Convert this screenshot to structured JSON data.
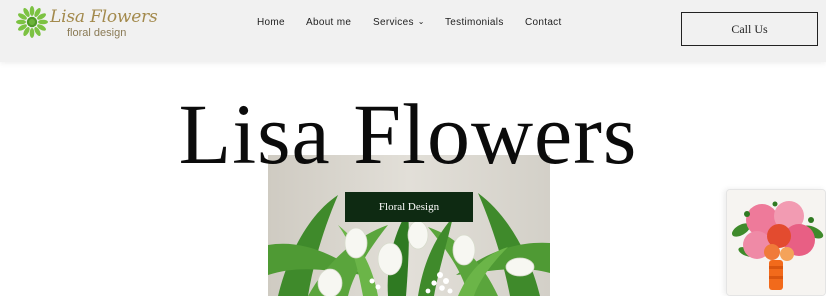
{
  "brand": {
    "name": "Lisa Flowers",
    "tagline": "floral design",
    "logo_icon": "daisy-icon",
    "name_color": "#a38a4d",
    "icon_color": "#7cc242"
  },
  "nav": {
    "items": [
      {
        "label": "Home"
      },
      {
        "label": "About me"
      },
      {
        "label": "Services",
        "icon": "chevron-down-icon"
      },
      {
        "label": "Testimonials"
      },
      {
        "label": "Contact"
      }
    ]
  },
  "header": {
    "call_label": "Call Us"
  },
  "hero": {
    "title": "Lisa Flowers",
    "button_label": "Floral Design",
    "button_color": "#0e2a12"
  }
}
